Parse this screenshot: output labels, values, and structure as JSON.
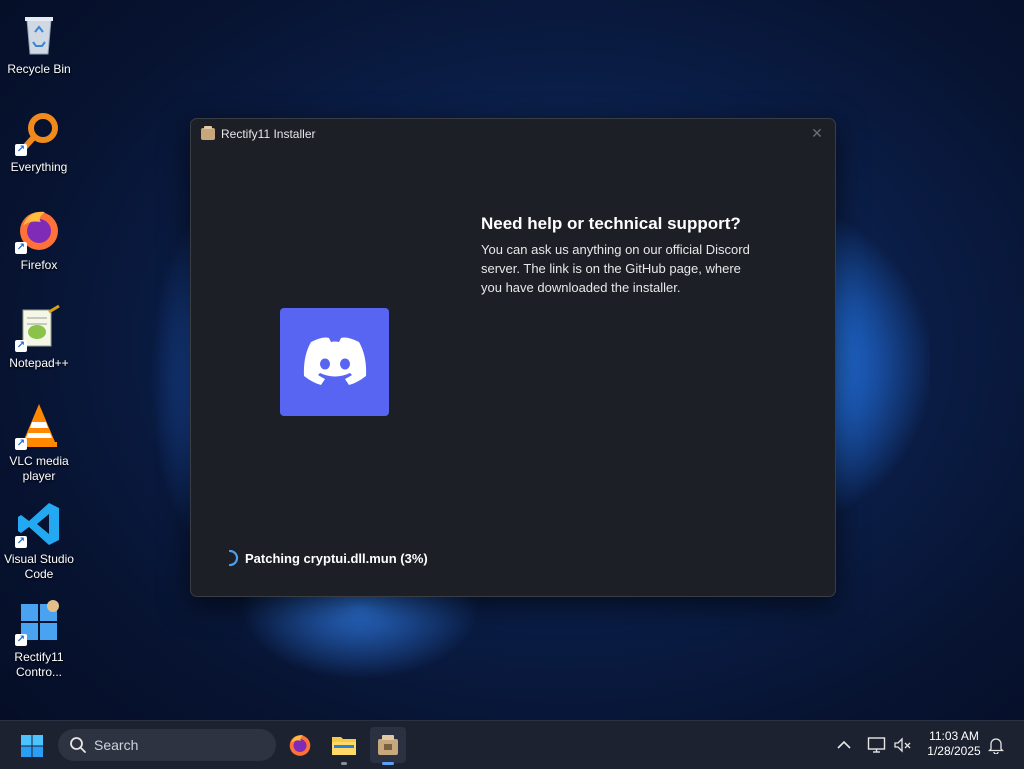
{
  "desktop": {
    "icons": [
      {
        "label": "Recycle Bin",
        "icon": "recycle-bin-icon",
        "shortcut": false
      },
      {
        "label": "Everything",
        "icon": "everything-search-icon",
        "shortcut": true
      },
      {
        "label": "Firefox",
        "icon": "firefox-icon",
        "shortcut": true
      },
      {
        "label": "Notepad++",
        "icon": "notepad-plus-plus-icon",
        "shortcut": true
      },
      {
        "label": "VLC media player",
        "icon": "vlc-icon",
        "shortcut": true
      },
      {
        "label": "Visual Studio Code",
        "icon": "vscode-icon",
        "shortcut": true
      },
      {
        "label": "Rectify11 Contro...",
        "icon": "rectify11-control-icon",
        "shortcut": true
      }
    ]
  },
  "window": {
    "title": "Rectify11 Installer",
    "help_heading": "Need help or technical support?",
    "help_body": "You can ask us anything on our official Discord server. The link is on the GitHub page, where you have downloaded the installer.",
    "status": "Patching cryptui.dll.mun (3%)",
    "progress_percent": 3,
    "logo": "discord-logo"
  },
  "taskbar": {
    "search_label": "Search",
    "apps": [
      "firefox-icon",
      "file-explorer-icon",
      "rectify11-installer-icon"
    ],
    "time": "11:03 AM",
    "date": "1/28/2025"
  },
  "colors": {
    "discord": "#5865f2",
    "window_bg": "#1c1f26",
    "accent": "#5aa0f5"
  }
}
